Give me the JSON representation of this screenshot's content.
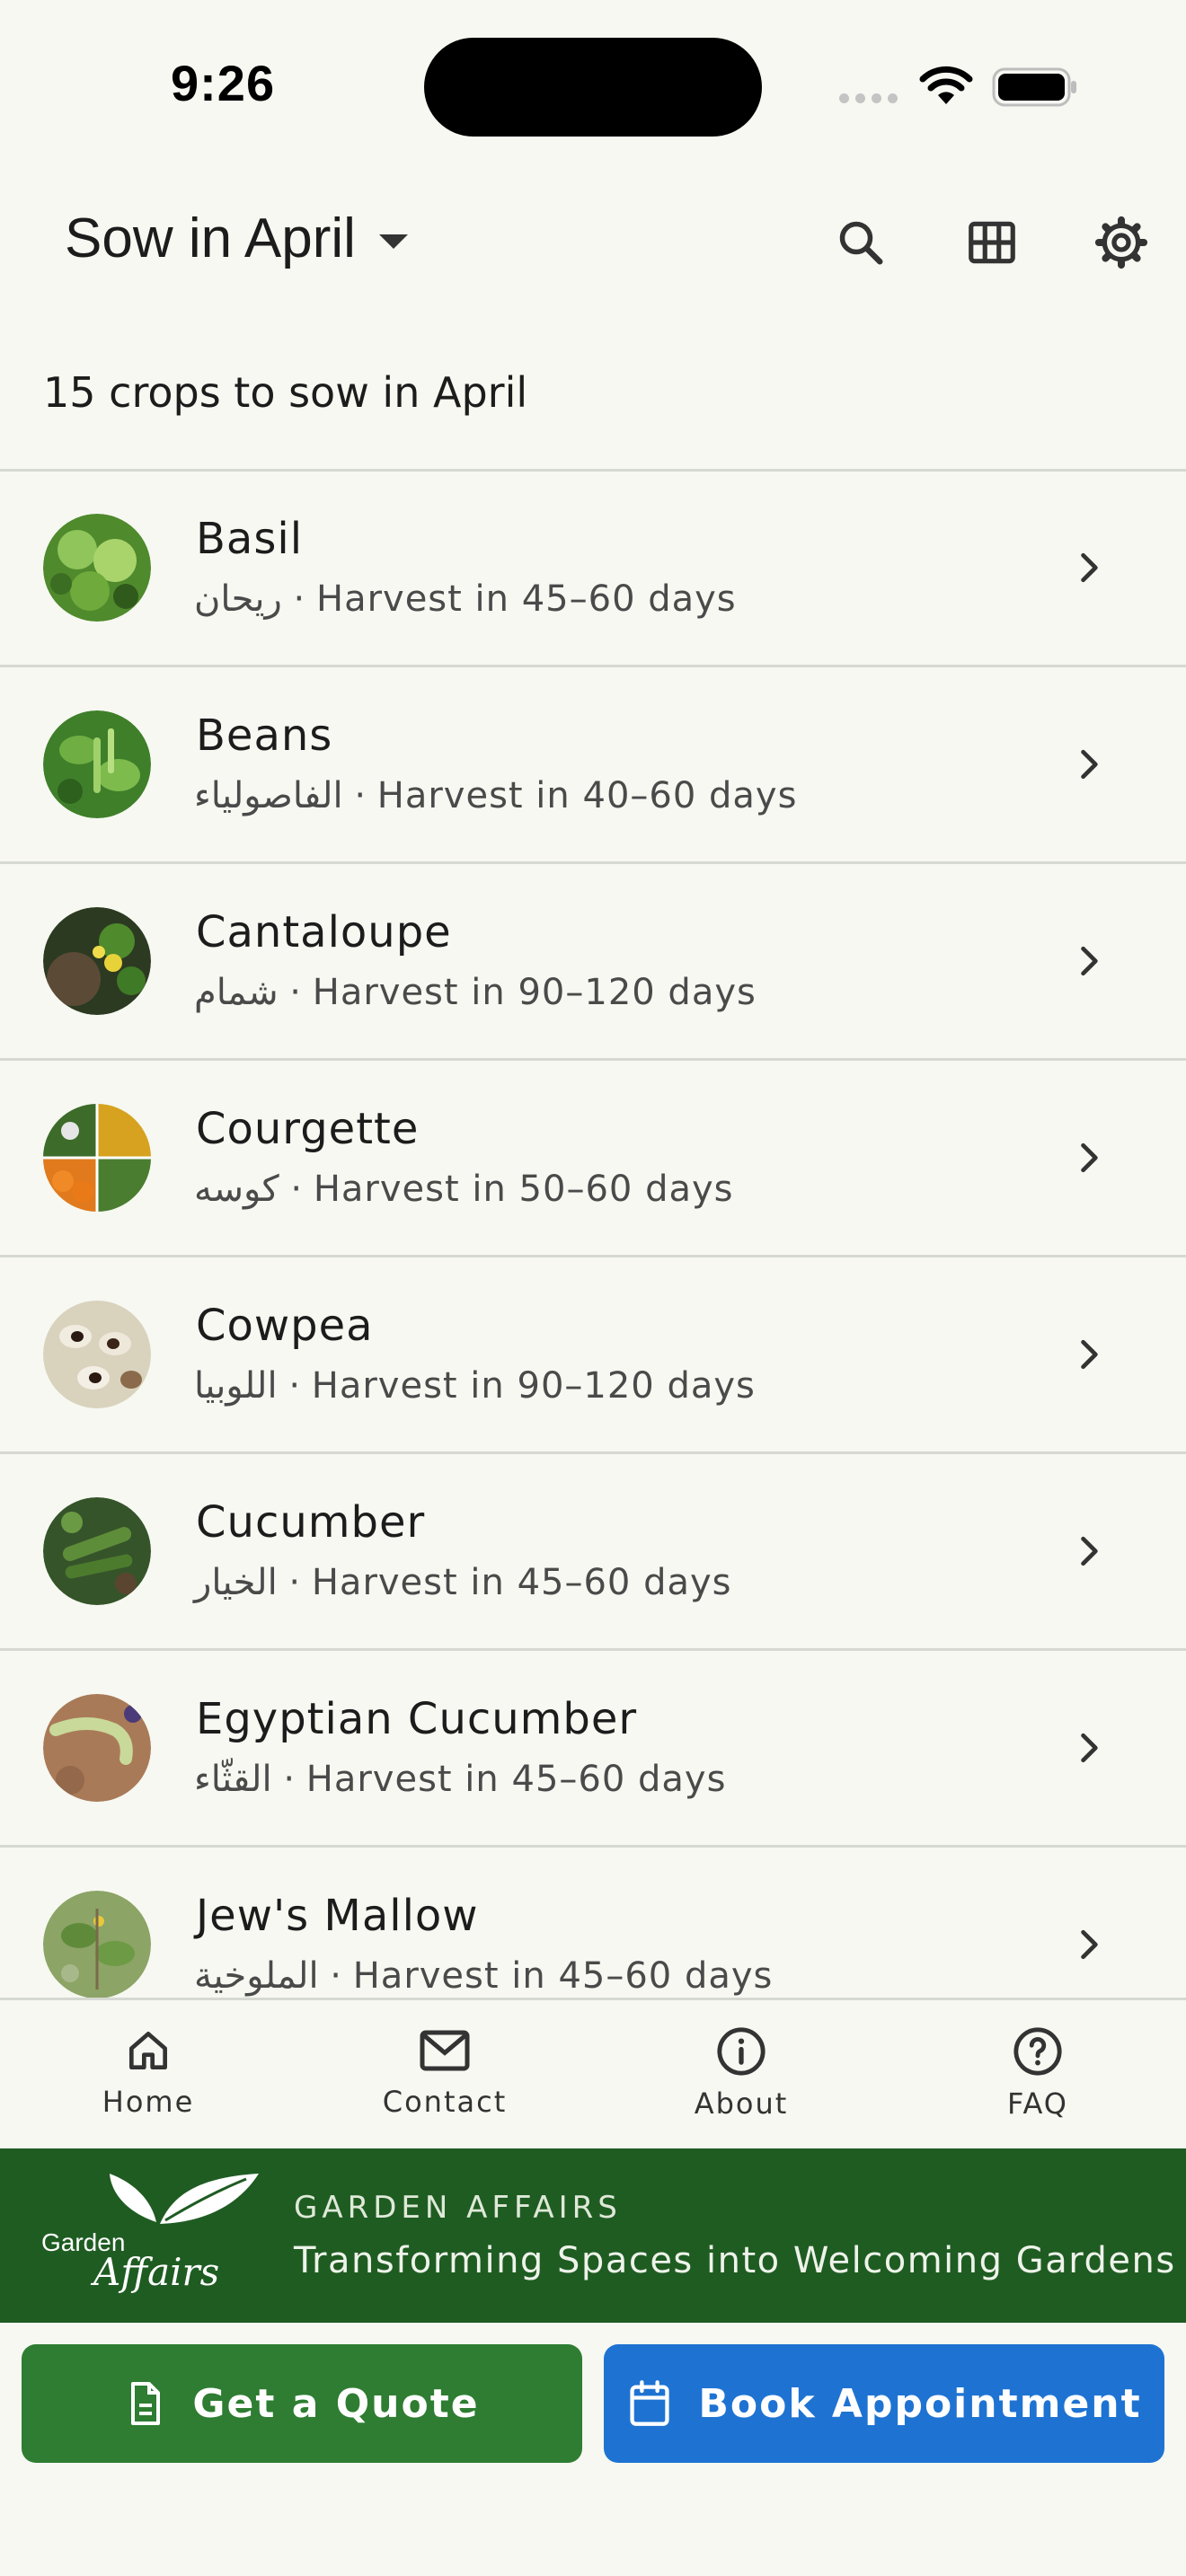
{
  "status_bar": {
    "time": "9:26"
  },
  "app_bar": {
    "title": "Sow in April"
  },
  "summary": "15 crops to sow in April",
  "crops": [
    {
      "name": "Basil",
      "subtitle": "ريحان · Harvest in 45–60 days"
    },
    {
      "name": "Beans",
      "subtitle": "الفاصولياء · Harvest in 40–60 days"
    },
    {
      "name": "Cantaloupe",
      "subtitle": "شمام · Harvest in 90–120 days"
    },
    {
      "name": "Courgette",
      "subtitle": "كوسه · Harvest in 50–60 days"
    },
    {
      "name": "Cowpea",
      "subtitle": "اللوبيا · Harvest in 90–120 days"
    },
    {
      "name": "Cucumber",
      "subtitle": "الخيار · Harvest in 45–60 days"
    },
    {
      "name": "Egyptian Cucumber",
      "subtitle": "القثّاء · Harvest in 45–60 days"
    },
    {
      "name": "Jew's Mallow",
      "subtitle": "الملوخية · Harvest in 45–60 days"
    }
  ],
  "nav": {
    "home": "Home",
    "contact": "Contact",
    "about": "About",
    "faq": "FAQ"
  },
  "banner": {
    "brand": "GARDEN AFFAIRS",
    "tagline": "Transforming Spaces into Welcoming Gardens",
    "logo_text_1": "Garden",
    "logo_text_2": "Affairs"
  },
  "actions": {
    "quote": "Get a Quote",
    "book": "Book Appointment"
  },
  "colors": {
    "background": "#f6f8f1",
    "banner": "#1f5c22",
    "quote_button": "#2e7d32",
    "book_button": "#1e73d2"
  },
  "icons": {
    "search": "search-icon",
    "grid": "grid-icon",
    "settings": "gear-icon",
    "home": "home-icon",
    "contact": "mail-icon",
    "about": "info-icon",
    "faq": "help-icon"
  }
}
